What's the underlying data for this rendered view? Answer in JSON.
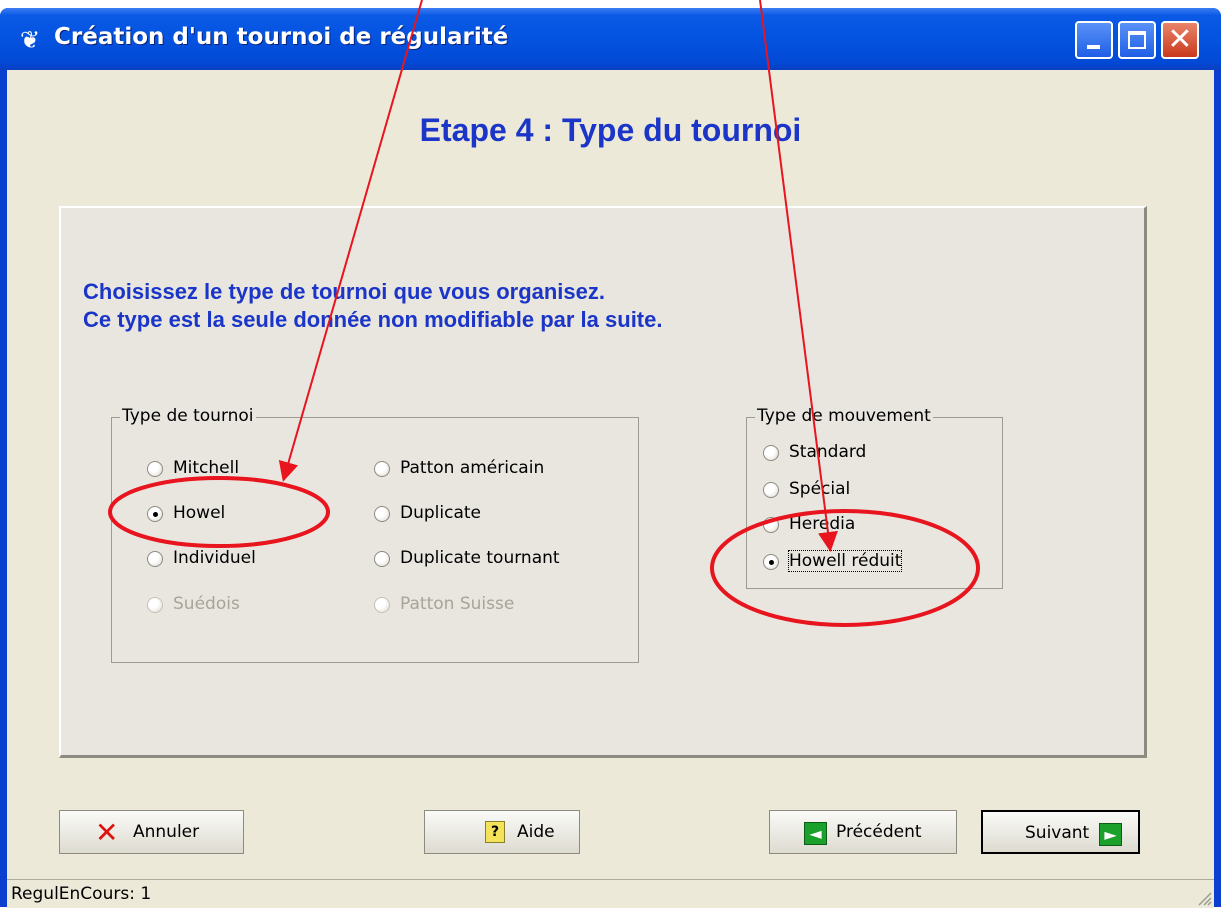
{
  "window": {
    "title": "Création d'un tournoi de régularité",
    "icon": "tournament-icon"
  },
  "heading": "Etape 4 : Type du tournoi",
  "instructions": [
    "Choisissez le type de tournoi que vous organisez.",
    "Ce type est la seule donnée non modifiable par la suite."
  ],
  "tournament_type": {
    "legend": "Type de tournoi",
    "options": [
      {
        "label": "Mitchell",
        "checked": false,
        "enabled": true
      },
      {
        "label": "Howel",
        "checked": true,
        "enabled": true
      },
      {
        "label": "Individuel",
        "checked": false,
        "enabled": true
      },
      {
        "label": "Suédois",
        "checked": false,
        "enabled": false
      },
      {
        "label": "Patton américain",
        "checked": false,
        "enabled": true
      },
      {
        "label": "Duplicate",
        "checked": false,
        "enabled": true
      },
      {
        "label": "Duplicate tournant",
        "checked": false,
        "enabled": true
      },
      {
        "label": "Patton Suisse",
        "checked": false,
        "enabled": false
      }
    ]
  },
  "movement_type": {
    "legend": "Type de mouvement",
    "options": [
      {
        "label": "Standard",
        "checked": false
      },
      {
        "label": "Spécial",
        "checked": false
      },
      {
        "label": "Heredia",
        "checked": false
      },
      {
        "label": "Howell réduit",
        "checked": true
      }
    ]
  },
  "buttons": {
    "cancel": "Annuler",
    "help": "Aide",
    "previous": "Précédent",
    "next": "Suivant"
  },
  "status": "RegulEnCours: 1",
  "annotation_color": "#e8141e"
}
